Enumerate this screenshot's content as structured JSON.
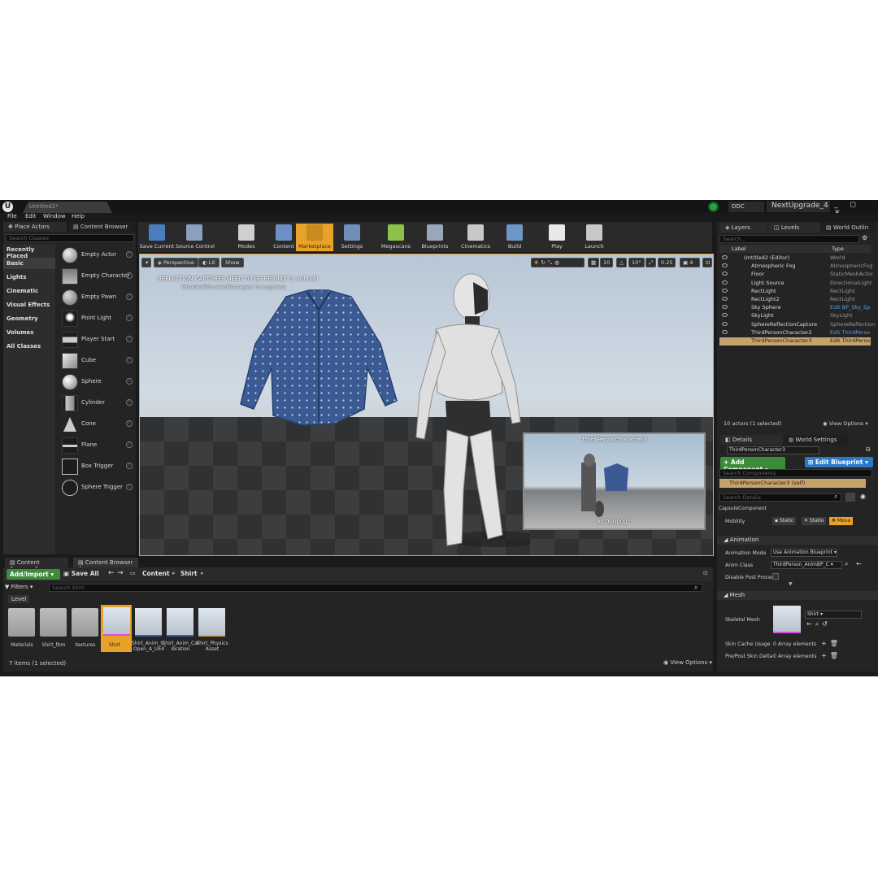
{
  "window": {
    "doc_tab": "Untitled2*",
    "ddc": "DDC",
    "project": "NextUpgrade_4",
    "controls": "_ ◻ ✕"
  },
  "menu": [
    "File",
    "Edit",
    "Window",
    "Help"
  ],
  "left": {
    "tabs": [
      "Place Actors",
      "Content Browser"
    ],
    "search_placeholder": "Search Classes",
    "categories": [
      "Recently Placed",
      "Basic",
      "Lights",
      "Cinematic",
      "Visual Effects",
      "Geometry",
      "Volumes",
      "All Classes"
    ],
    "actors": [
      "Empty Actor",
      "Empty Character",
      "Empty Pawn",
      "Point Light",
      "Player Start",
      "Cube",
      "Sphere",
      "Cylinder",
      "Cone",
      "Plane",
      "Box Trigger",
      "Sphere Trigger"
    ]
  },
  "toolbar": {
    "buttons": [
      {
        "label": "Save Current",
        "color": "#4a7fbf"
      },
      {
        "label": "Source Control",
        "color": "#8aa0c0"
      },
      {
        "label": "Modes",
        "color": "#cfcfcf"
      },
      {
        "label": "Content",
        "color": "#6d8fc7"
      },
      {
        "label": "Marketplace",
        "color": "#c98a1e"
      },
      {
        "label": "Settings",
        "color": "#6f8fb7"
      },
      {
        "label": "Megascans",
        "color": "#8bc34a"
      },
      {
        "label": "Blueprints",
        "color": "#9aa7b8"
      },
      {
        "label": "Cinematics",
        "color": "#c8c8c8"
      },
      {
        "label": "Build",
        "color": "#6f96c8"
      },
      {
        "label": "Play",
        "color": "#e8e8e8"
      },
      {
        "label": "Launch",
        "color": "#c8c8c8"
      }
    ]
  },
  "viewport": {
    "perspective": "Perspective",
    "lit": "Lit",
    "show": "Show",
    "grid": "10",
    "angle": "10°",
    "scale": "0.25",
    "cam": "4",
    "warning": "REFLECTION CAPTURES NEED TO BE REBUILT (1 unbuilt)",
    "warning_hint": "'DisableAllScreenMessages' to suppress",
    "preview_title": "ThirdPersonCharacter3",
    "preview_value": "90.000000 °"
  },
  "content_browser": {
    "tabs": [
      "Content Browser 3",
      "Content Browser 4"
    ],
    "add_import": "Add/Import",
    "save_all": "Save All",
    "path": [
      "Content",
      "Shirt"
    ],
    "filters": "Filters",
    "search_placeholder": "Search Shirt",
    "filter_chip": "Level",
    "assets": [
      {
        "name": "Materials",
        "kind": "folder"
      },
      {
        "name": "Shirt_fbm",
        "kind": "folder"
      },
      {
        "name": "textures",
        "kind": "folder"
      },
      {
        "name": "Shirt",
        "kind": "mesh",
        "selected": true
      },
      {
        "name": "Shirt_Anim_0_Open_A_UE4",
        "kind": "anim"
      },
      {
        "name": "Shirt_Anim_Calibration",
        "kind": "anim"
      },
      {
        "name": "Shirt_Physics Asset",
        "kind": "physics"
      }
    ],
    "status": "7 items (1 selected)",
    "view_options": "View Options"
  },
  "outliner": {
    "tabs": [
      "Layers",
      "Levels",
      "World Outlin"
    ],
    "search_placeholder": "Search...",
    "col_label": "Label",
    "col_type": "Type",
    "rows": [
      {
        "label": "Untitled2 (Editor)",
        "type": "World",
        "link": false
      },
      {
        "label": "Atmospheric Fog",
        "type": "AtmosphericFog",
        "link": false
      },
      {
        "label": "Floor",
        "type": "StaticMeshActor",
        "link": false
      },
      {
        "label": "Light Source",
        "type": "DirectionalLight",
        "link": false
      },
      {
        "label": "RectLight",
        "type": "RectLight",
        "link": false
      },
      {
        "label": "RectLight2",
        "type": "RectLight",
        "link": false
      },
      {
        "label": "Sky Sphere",
        "type": "Edit BP_Sky_Sp",
        "link": true
      },
      {
        "label": "SkyLight",
        "type": "SkyLight",
        "link": false
      },
      {
        "label": "SphereReflectionCapture",
        "type": "SphereReflection",
        "link": false
      },
      {
        "label": "ThirdPersonCharacter2",
        "type": "Edit ThirdPerso",
        "link": true
      },
      {
        "label": "ThirdPersonCharacter3",
        "type": "Edit ThirdPerso",
        "link": true,
        "selected": true
      }
    ],
    "count": "10 actors (1 selected)",
    "view_options": "View Options"
  },
  "details": {
    "tabs": [
      "Details",
      "World Settings"
    ],
    "name": "ThirdPersonCharacter3",
    "add_component": "+ Add Component",
    "edit_blueprint": "Edit Blueprint",
    "search_components": "Search Components",
    "self_row": "ThirdPersonCharacter3 (self)",
    "search_details": "Search Details",
    "capsule": "CapsuleComponent",
    "mobility_label": "Mobility",
    "mobility": [
      "Static",
      "Statio",
      "Mova"
    ],
    "sec_animation": "Animation",
    "anim_mode_label": "Animation Mode",
    "anim_mode": "Use Animation Blueprint",
    "anim_class_label": "Anim Class",
    "anim_class": "ThirdPerson_AnimBP_C",
    "disable_post_label": "Disable Post Proces",
    "sec_mesh": "Mesh",
    "skeletal_mesh_label": "Skeletal Mesh",
    "skeletal_mesh": "Shirt",
    "skin_cache_label": "Skin Cache Usage",
    "skin_cache": "0 Array elements",
    "pre_post_label": "Pre/Post Skin Delta",
    "pre_post": "0 Array elements"
  }
}
